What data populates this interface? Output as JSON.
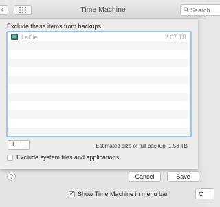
{
  "window": {
    "title": "Time Machine",
    "search_placeholder": "Search",
    "back_glyph": "‹"
  },
  "sheet": {
    "heading": "Exclude these items from backups:",
    "items": [
      {
        "name": "LaCie",
        "size": "2.67 TB"
      }
    ],
    "add_label": "+",
    "remove_label": "−",
    "backup_size_text": "Estimated size of full backup: 1.53 TB",
    "exclude_system_label": "Exclude system files and applications",
    "exclude_system_checked": false,
    "help_label": "?",
    "cancel_label": "Cancel",
    "save_label": "Save"
  },
  "background": {
    "show_menu_bar_label": "Show Time Machine in menu bar",
    "show_menu_bar_checked": true,
    "checkmark": "✓",
    "partial_button_label": "C"
  }
}
